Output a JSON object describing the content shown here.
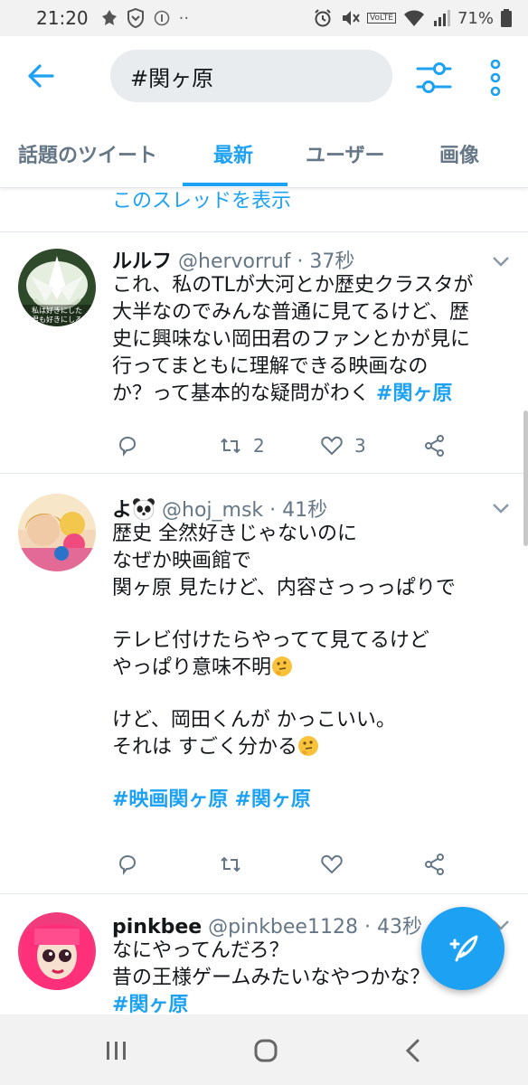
{
  "status": {
    "time": "21:20",
    "battery": "71%",
    "volte": "VoLTE"
  },
  "search": {
    "query": "#関ヶ原"
  },
  "tabs": [
    {
      "label": "話題のツイート"
    },
    {
      "label": "最新"
    },
    {
      "label": "ユーザー"
    },
    {
      "label": "画像"
    }
  ],
  "thread_link": "このスレッドを表示",
  "tweets": [
    {
      "name": "ルルフ",
      "handle": "@hervorruf",
      "time": "37秒",
      "body": [
        "これ、私のTLが大河とか歴史クラスタが",
        "大半なのでみんな普通に見てるけど、歴",
        "史に興味ない岡田君のファンとかが見に",
        "行ってまともに理解できる映画なの"
      ],
      "body_last": "か？って基本的な疑問がわく",
      "hashtag": "#関ヶ原",
      "retweets": "2",
      "likes": "3",
      "avatar_caption": "私は好きにした 君も好きにしろ"
    },
    {
      "name": "よ",
      "handle": "@hoj_msk",
      "time": "41秒",
      "lines_a": [
        "歴史 全然好きじゃないのに",
        "なぜか映画館で",
        "関ヶ原 見たけど、内容さっっっぱりで"
      ],
      "line_b1": "テレビ付けたらやってて見てるけど",
      "line_b2": "やっぱり意味不明",
      "line_c1": "けど、岡田くんが かっこいい。",
      "line_c2": "それは すごく分かる",
      "hashtags": [
        "#映画関ヶ原",
        "#関ヶ原"
      ]
    },
    {
      "name": "pinkbee",
      "handle": "@pinkbee1128",
      "time": "43秒",
      "body": [
        "なにやってんだろ？",
        "昔の王様ゲームみたいなやつかな？"
      ],
      "hashtag": "#関ヶ原"
    }
  ],
  "colors": {
    "accent": "#1da1f2",
    "muted": "#657786",
    "text": "#14171a"
  }
}
